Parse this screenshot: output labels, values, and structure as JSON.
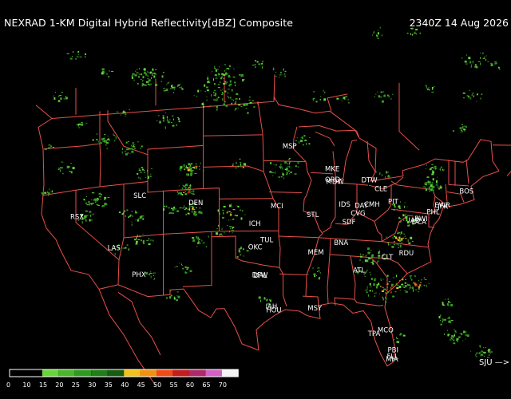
{
  "header": {
    "title": "NEXRAD 1-KM Digital Hybrid Reflectivity[dBZ] Composite",
    "timestamp": "2340Z 14 Aug 2026"
  },
  "colors": {
    "background": "#000000",
    "borders": "#e8504a",
    "station_text": "#ffffff"
  },
  "cities": [
    {
      "label": "BOS",
      "lon": -71.06,
      "lat": 42.36
    },
    {
      "label": "JFK",
      "lon": -73.78,
      "lat": 40.64
    },
    {
      "label": "EWR",
      "lon": -74.17,
      "lat": 40.69
    },
    {
      "label": "PHL",
      "lon": -75.16,
      "lat": 39.95
    },
    {
      "label": "BWI",
      "lon": -76.67,
      "lat": 39.18
    },
    {
      "label": "IAD",
      "lon": -77.45,
      "lat": 38.95
    },
    {
      "label": "DCA",
      "lon": -77.04,
      "lat": 38.85
    },
    {
      "label": "PIT",
      "lon": -80.0,
      "lat": 40.44
    },
    {
      "label": "CLE",
      "lon": -81.69,
      "lat": 41.5
    },
    {
      "label": "DTW",
      "lon": -83.35,
      "lat": 42.21
    },
    {
      "label": "CMH",
      "lon": -82.99,
      "lat": 39.96
    },
    {
      "label": "DAY",
      "lon": -84.19,
      "lat": 39.76
    },
    {
      "label": "CVG",
      "lon": -84.67,
      "lat": 39.05
    },
    {
      "label": "SDF",
      "lon": -85.74,
      "lat": 38.17
    },
    {
      "label": "IDS",
      "lon": -86.16,
      "lat": 39.77
    },
    {
      "label": "ORD",
      "lon": -87.9,
      "lat": 41.98
    },
    {
      "label": "MDW",
      "lon": -87.75,
      "lat": 41.79
    },
    {
      "label": "MKE",
      "lon": -87.9,
      "lat": 42.95
    },
    {
      "label": "MSP",
      "lon": -93.22,
      "lat": 44.88
    },
    {
      "label": "STL",
      "lon": -90.2,
      "lat": 38.63
    },
    {
      "label": "MCI",
      "lon": -94.71,
      "lat": 39.3
    },
    {
      "label": "ICH",
      "lon": -97.43,
      "lat": 37.65
    },
    {
      "label": "TUL",
      "lon": -95.99,
      "lat": 36.15
    },
    {
      "label": "OKC",
      "lon": -97.52,
      "lat": 35.47
    },
    {
      "label": "DFW",
      "lon": -97.04,
      "lat": 32.9
    },
    {
      "label": "DAL",
      "lon": -96.85,
      "lat": 32.85
    },
    {
      "label": "IAH",
      "lon": -95.34,
      "lat": 29.98
    },
    {
      "label": "HOU",
      "lon": -95.28,
      "lat": 29.65
    },
    {
      "label": "MSY",
      "lon": -90.07,
      "lat": 29.95
    },
    {
      "label": "MEM",
      "lon": -90.05,
      "lat": 35.14
    },
    {
      "label": "BNA",
      "lon": -86.78,
      "lat": 36.16
    },
    {
      "label": "ATL",
      "lon": -84.39,
      "lat": 33.75
    },
    {
      "label": "CLT",
      "lon": -80.84,
      "lat": 35.23
    },
    {
      "label": "RDU",
      "lon": -78.64,
      "lat": 35.78
    },
    {
      "label": "MCO",
      "lon": -81.31,
      "lat": 28.43
    },
    {
      "label": "TPA",
      "lon": -82.53,
      "lat": 27.98
    },
    {
      "label": "PBI",
      "lon": -80.05,
      "lat": 26.68
    },
    {
      "label": "FLL",
      "lon": -80.15,
      "lat": 26.07
    },
    {
      "label": "MIA",
      "lon": -80.29,
      "lat": 25.79
    },
    {
      "label": "DEN",
      "lon": -104.99,
      "lat": 39.74
    },
    {
      "label": "SLC",
      "lon": -111.89,
      "lat": 40.76
    },
    {
      "label": "PHX",
      "lon": -112.07,
      "lat": 33.45
    },
    {
      "label": "LAS",
      "lon": -115.14,
      "lat": 36.17
    },
    {
      "label": "RSX",
      "lon": -119.8,
      "lat": 39.53
    }
  ],
  "legend": {
    "ticks": [
      "0",
      "10",
      "15",
      "20",
      "25",
      "30",
      "35",
      "40",
      "45",
      "50",
      "55",
      "60",
      "65",
      "70"
    ],
    "colors": [
      "#000000",
      "#000000",
      "#66d63c",
      "#4bb52b",
      "#2f9a22",
      "#227d1a",
      "#185c13",
      "#f2c21a",
      "#f19114",
      "#f04a1a",
      "#c41d1d",
      "#ac2a68",
      "#cf63c3",
      "#f4f4f4"
    ]
  },
  "footer": {
    "jump_label": "SJU —>"
  }
}
